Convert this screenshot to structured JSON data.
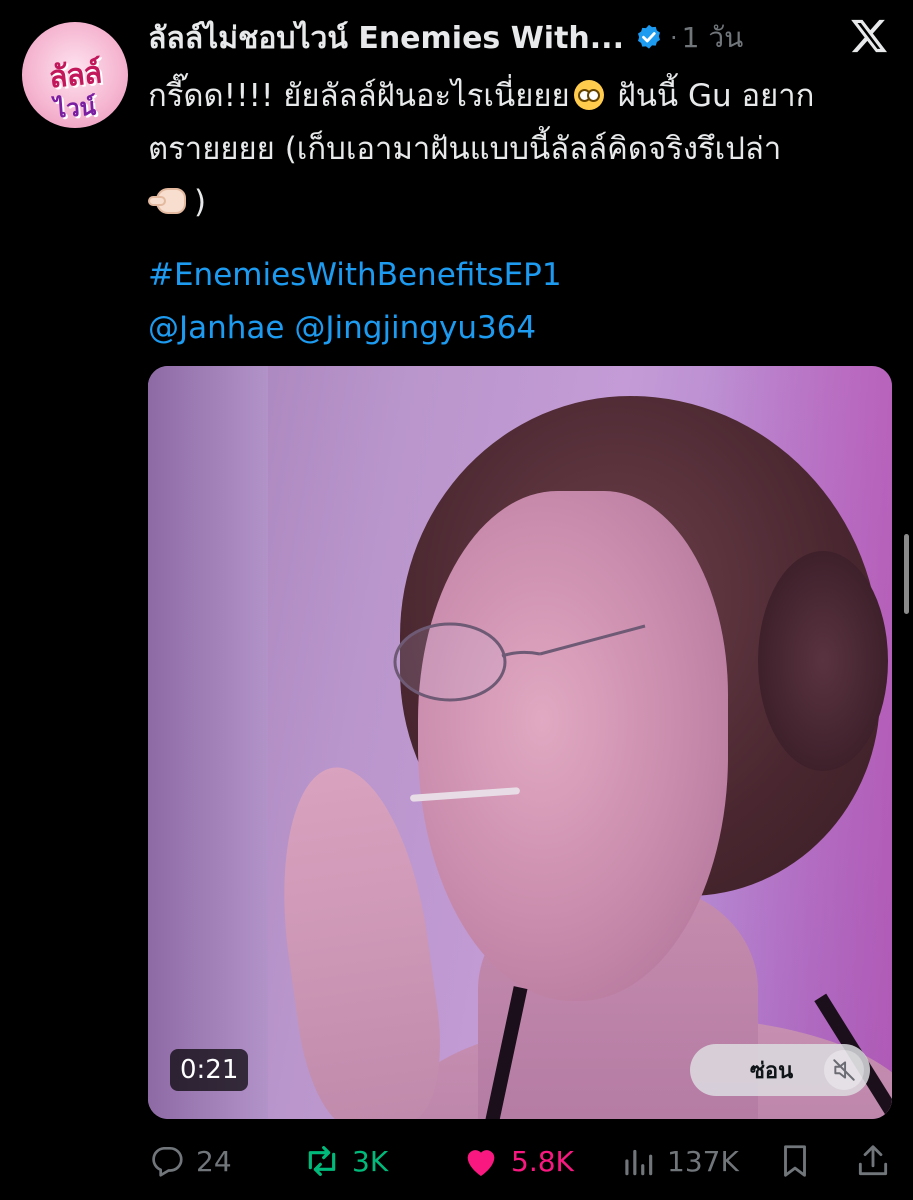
{
  "author": {
    "display_name": "ลัลล์ไม่ชอบไวน์ Enemies With...",
    "time_separator": "·",
    "time": "1 วัน"
  },
  "tweet": {
    "lines": [
      "กรี๊ดด!!!! ยัยลัลล์ฝันอะไรเนี่ยยย",
      " ฝันนี้ Gu อยาก",
      "ตรายยยย (เก็บเอามาฝันแบบนี้ลัลล์คิดจริงรึเปล่า",
      ")"
    ],
    "emoji_1": "flushed-face-emoji",
    "emoji_2": "backhand-index-pointing-emoji",
    "hashtag": "#EnemiesWithBenefitsEP1",
    "mentions": "@Janhae @Jingjingyu364"
  },
  "media": {
    "duration": "0:21",
    "hide_label": "ซ่อน",
    "muted": true
  },
  "actions": {
    "replies": "24",
    "retweets": "3K",
    "likes": "5.8K",
    "views": "137K"
  },
  "icons": {
    "verified": "verified-badge-icon",
    "platform": "x-logo-icon",
    "reply": "reply-icon",
    "retweet": "retweet-icon",
    "like": "heart-icon",
    "views": "views-icon",
    "bookmark": "bookmark-icon",
    "share": "share-icon",
    "mute": "speaker-muted-icon"
  },
  "colors": {
    "background": "#000000",
    "text": "#e7e9ea",
    "secondary": "#71767b",
    "link": "#1d9bf0",
    "retweet_active": "#00ba7c",
    "like_active": "#f91880"
  }
}
